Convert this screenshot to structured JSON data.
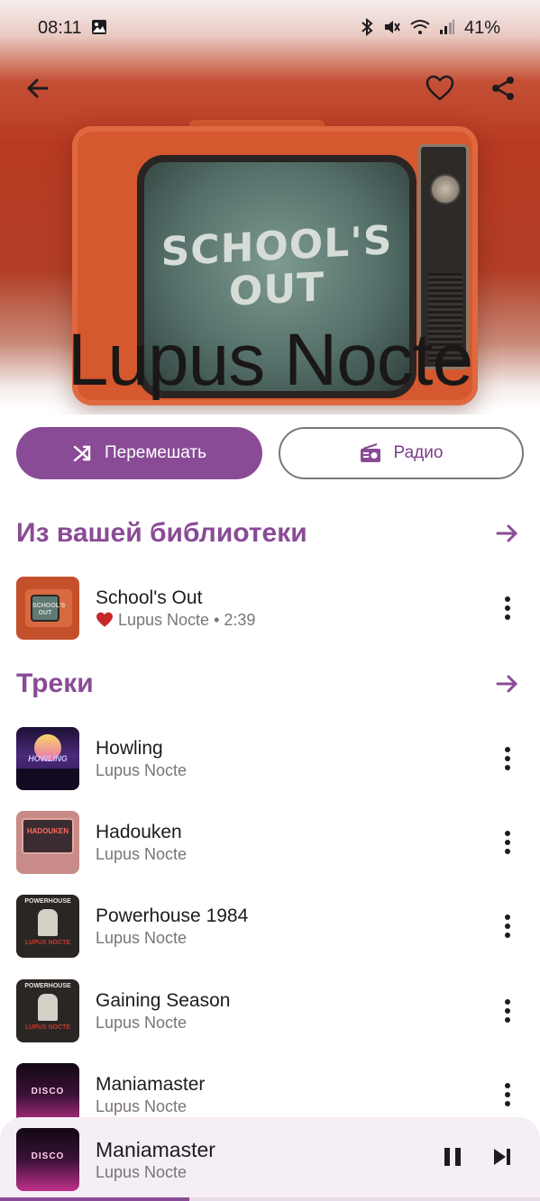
{
  "status_bar": {
    "time": "08:11",
    "battery": "41%"
  },
  "header": {
    "artist": "Lupus Nocte",
    "cover_text": "SCHOOL'S OUT"
  },
  "actions": {
    "shuffle_label": "Перемешать",
    "radio_label": "Радио"
  },
  "library_section": {
    "title": "Из вашей библиотеки",
    "items": [
      {
        "title": "School's Out",
        "artist": "Lupus Nocte",
        "duration": "2:39",
        "liked": true,
        "art_text": "SCHOOL'S OUT"
      }
    ]
  },
  "tracks_section": {
    "title": "Треки",
    "items": [
      {
        "title": "Howling",
        "artist": "Lupus Nocte",
        "art_text": "HOWLING"
      },
      {
        "title": "Hadouken",
        "artist": "Lupus Nocte",
        "art_text": "HADOUKEN"
      },
      {
        "title": "Powerhouse 1984",
        "artist": "Lupus Nocte",
        "art_text_top": "POWERHOUSE",
        "art_text_bottom": "LUPUS NOCTE"
      },
      {
        "title": "Gaining Season",
        "artist": "Lupus Nocte",
        "art_text_top": "POWERHOUSE",
        "art_text_bottom": "LUPUS NOCTE"
      },
      {
        "title": "Maniamaster",
        "artist": "Lupus Nocte",
        "art_text": "DISCO"
      }
    ]
  },
  "now_playing": {
    "title": "Maniamaster",
    "artist": "Lupus Nocte",
    "art_text": "DISCO",
    "progress": 0.35
  },
  "colors": {
    "accent": "#8a4b96",
    "heart": "#c62828"
  }
}
